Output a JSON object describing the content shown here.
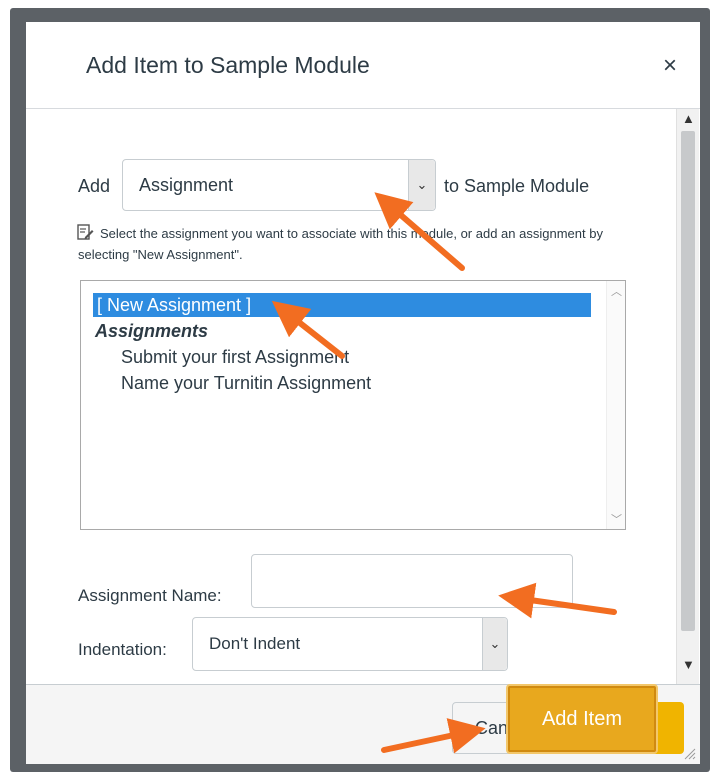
{
  "dialog": {
    "title": "Add Item to Sample Module",
    "close_glyph": "×"
  },
  "add_row": {
    "add_label": "Add",
    "type_value": "Assignment",
    "to_label": "to Sample Module"
  },
  "help": {
    "icon": "edit-doc-icon",
    "text": "Select the assignment you want to associate with this module, or add an assignment by selecting \"New Assignment\"."
  },
  "list": {
    "selected": "[ New Assignment ]",
    "group": "Assignments",
    "items": [
      "Submit your first Assignment",
      "Name your Turnitin Assignment"
    ]
  },
  "form": {
    "name_label": "Assignment Name:",
    "name_value": "",
    "indent_label": "Indentation:",
    "indent_value": "Don't Indent"
  },
  "footer": {
    "cancel_label": "Cancel",
    "add_label": "Add Item"
  },
  "annotation": {
    "arrow_color": "#f26d21",
    "highlight_color": "#e8a81e"
  }
}
